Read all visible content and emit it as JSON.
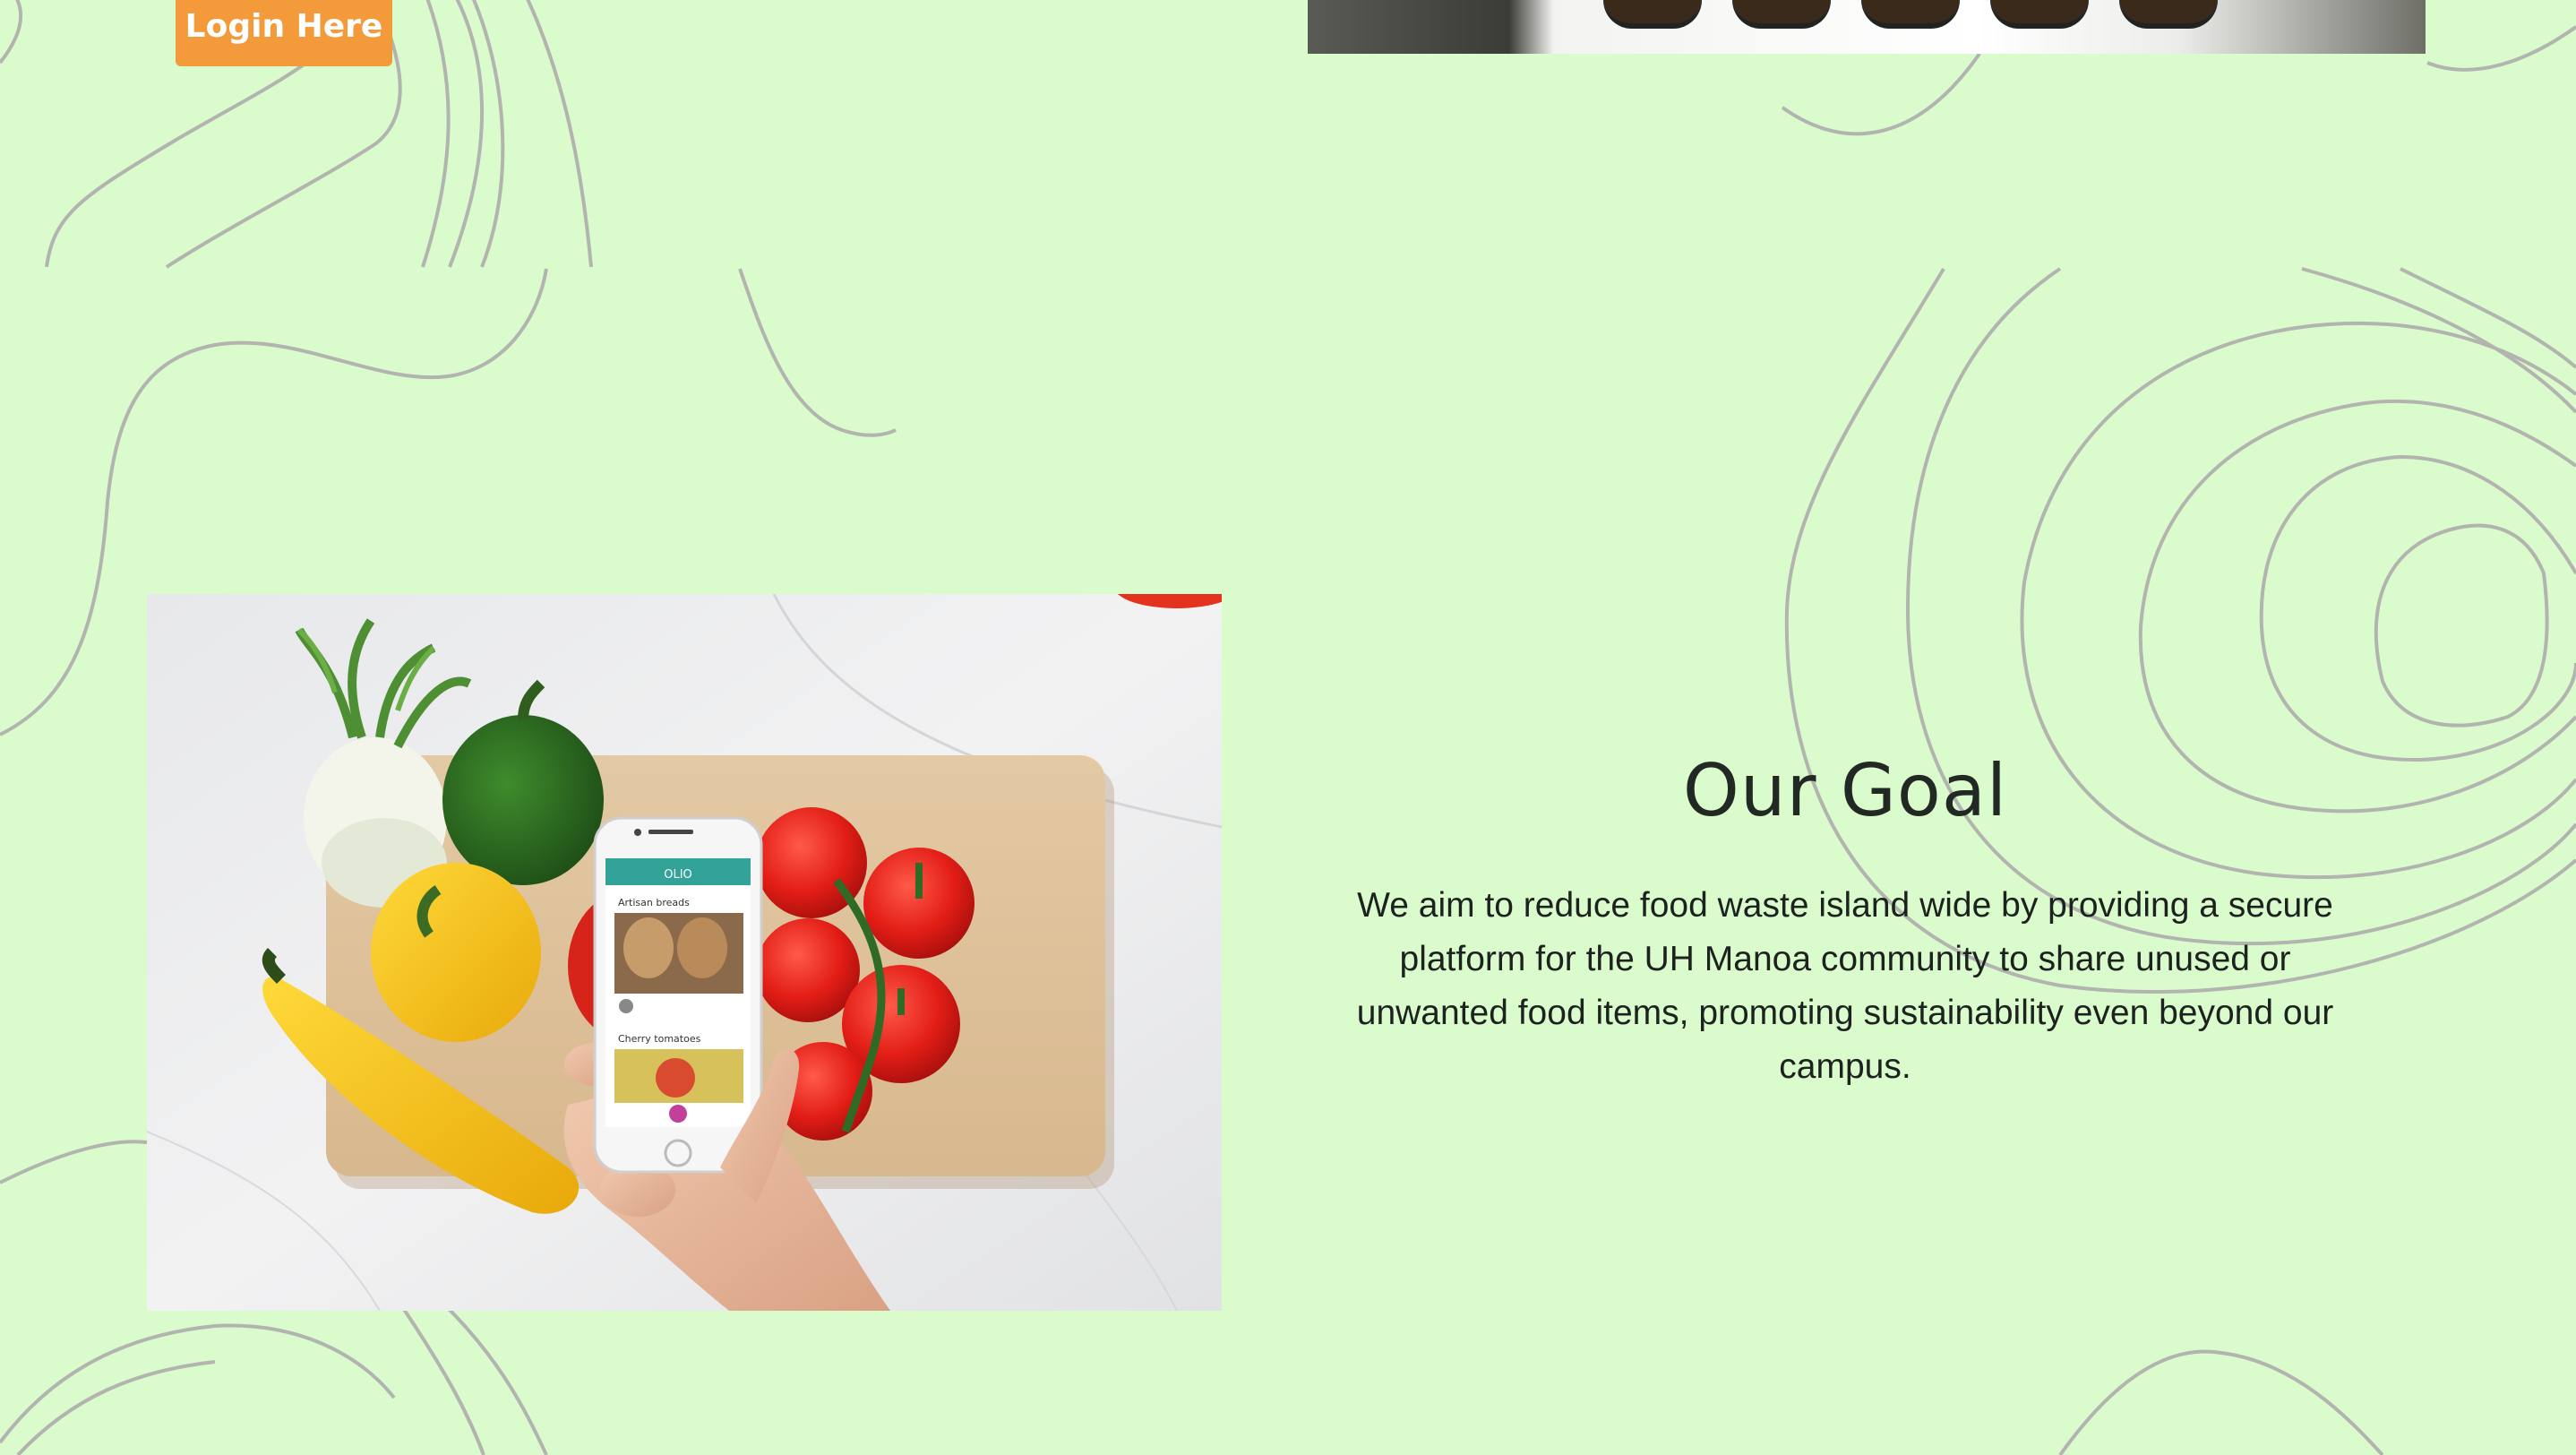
{
  "header": {
    "login_button_label": "Login Here"
  },
  "goal_section": {
    "title": "Our Goal",
    "description": "We aim to reduce food waste island wide by providing a secure platform for the UH Manoa community to share unused or unwanted food items, promoting sustainability even beyond our campus."
  },
  "phone_screen": {
    "app_name": "OLIO",
    "item_1": "Artisan breads",
    "item_2": "Cherry tomatoes"
  },
  "colors": {
    "background": "#dafccc",
    "accent_button": "#f39a3b",
    "contour_lines": "#b3b3b0",
    "heading_text": "#222823"
  }
}
